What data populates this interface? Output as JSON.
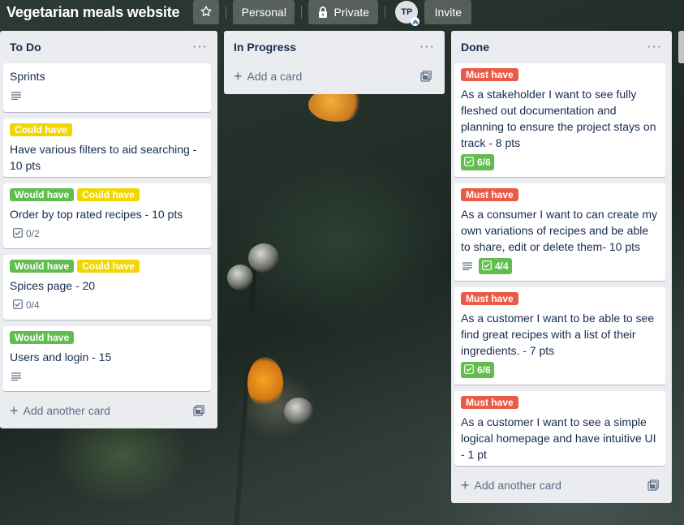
{
  "board": {
    "title": "Vegetarian meals website",
    "team_label": "Personal",
    "visibility_label": "Private",
    "member_initials": "TP",
    "invite_label": "Invite"
  },
  "add_card_label": "Add a card",
  "add_another_card_label": "Add another card",
  "menu_glyph": "···",
  "icons": [
    "star-icon",
    "lock-icon",
    "description-icon",
    "checklist-icon",
    "template-icon",
    "plus-icon",
    "more-icon"
  ],
  "colors": {
    "label_green": "#61bd4f",
    "label_yellow": "#f2d600",
    "label_red": "#eb5a46",
    "list_bg": "#ebecf0"
  },
  "lists": [
    {
      "title": "To Do",
      "cards": [
        {
          "title": "Sprints",
          "labels": [],
          "has_description": true
        },
        {
          "title": "Have various filters to aid searching - 10 pts",
          "labels": [
            "Could have"
          ]
        },
        {
          "title": "Order by top rated recipes - 10 pts",
          "labels": [
            "Would have",
            "Could have"
          ],
          "checklist": "0/2"
        },
        {
          "title": "Spices page - 20",
          "labels": [
            "Would have",
            "Could have"
          ],
          "checklist": "0/4"
        },
        {
          "title": "Users and login - 15",
          "labels": [
            "Would have"
          ],
          "has_description": true
        }
      ]
    },
    {
      "title": "In Progress",
      "cards": []
    },
    {
      "title": "Done",
      "cards": [
        {
          "title": "As a stakeholder I want to see fully fleshed out documentation and planning to ensure the project stays on track - 8 pts",
          "labels": [
            "Must have"
          ],
          "checklist": "6/6"
        },
        {
          "title": "As a consumer I want to can create my own variations of recipes and be able to share, edit or delete them- 10 pts",
          "labels": [
            "Must have"
          ],
          "has_description": true,
          "checklist": "4/4"
        },
        {
          "title": "As a customer I want to be able to see find great recipes with a list of their ingredients. - 7 pts",
          "labels": [
            "Must have"
          ],
          "checklist": "6/6"
        },
        {
          "title": "As a customer I want to see a simple logical homepage and have intuitive UI - 1 pt",
          "labels": [
            "Must have"
          ]
        }
      ]
    }
  ]
}
